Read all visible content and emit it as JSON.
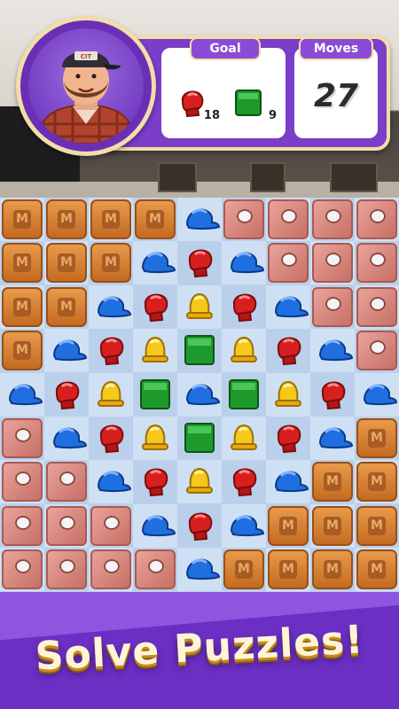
{
  "hud": {
    "goal_label": "Goal",
    "moves_label": "Moves",
    "moves_value": "27",
    "goals": [
      {
        "icon": "boxing-glove-icon",
        "count": "18"
      },
      {
        "icon": "green-block-icon",
        "count": "9"
      }
    ]
  },
  "board": {
    "columns": 9,
    "rows": 9,
    "grid": [
      [
        "crate",
        "crate",
        "crate",
        "crate",
        "cap",
        "marble",
        "marble",
        "marble",
        "marble"
      ],
      [
        "crate",
        "crate",
        "crate",
        "cap",
        "glove",
        "cap",
        "marble",
        "marble",
        "marble"
      ],
      [
        "crate",
        "crate",
        "cap",
        "glove",
        "bell",
        "glove",
        "cap",
        "marble",
        "marble"
      ],
      [
        "crate",
        "cap",
        "glove",
        "bell",
        "block",
        "bell",
        "glove",
        "cap",
        "marble"
      ],
      [
        "cap",
        "glove",
        "bell",
        "block",
        "cap",
        "block",
        "bell",
        "glove",
        "cap"
      ],
      [
        "marble",
        "cap",
        "glove",
        "bell",
        "block",
        "bell",
        "glove",
        "cap",
        "crate"
      ],
      [
        "marble",
        "marble",
        "cap",
        "glove",
        "bell",
        "glove",
        "cap",
        "crate",
        "crate"
      ],
      [
        "marble",
        "marble",
        "marble",
        "cap",
        "glove",
        "cap",
        "crate",
        "crate",
        "crate"
      ],
      [
        "marble",
        "marble",
        "marble",
        "marble",
        "cap",
        "crate",
        "crate",
        "crate",
        "crate"
      ]
    ],
    "crate_letter": "M",
    "colors": {
      "cap": "#1f6fe0",
      "glove": "#d81f1f",
      "bell": "#f5c81a",
      "block": "#1e9a2c",
      "crate": "#d9822f",
      "marble": "#d88a80"
    }
  },
  "footer": {
    "title": "Solve Puzzles!"
  },
  "colors": {
    "panel_purple": "#7a3ec9",
    "panel_border": "#f2dca8",
    "footer_purple": "#6b2fc4"
  }
}
